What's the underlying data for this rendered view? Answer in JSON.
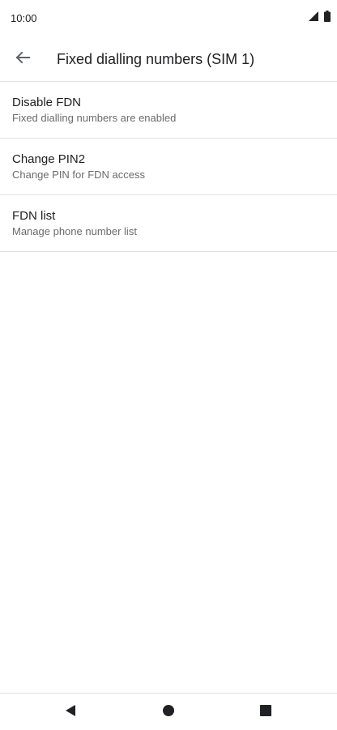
{
  "status_bar": {
    "time": "10:00",
    "icons": [
      "signal-icon",
      "battery-icon"
    ]
  },
  "app_bar": {
    "back_icon": "arrow-back-icon",
    "title": "Fixed dialling numbers (SIM 1)"
  },
  "settings": [
    {
      "title": "Disable FDN",
      "summary": "Fixed dialling numbers are enabled"
    },
    {
      "title": "Change PIN2",
      "summary": "Change PIN for FDN access"
    },
    {
      "title": "FDN list",
      "summary": "Manage phone number list"
    }
  ],
  "nav_bar": {
    "icons": [
      "nav-back-icon",
      "nav-home-icon",
      "nav-recents-icon"
    ]
  },
  "colors": {
    "text_primary": "#202124",
    "text_secondary": "#6b6b6b",
    "divider": "#e0e0e0",
    "icon_gray": "#5f6368"
  }
}
